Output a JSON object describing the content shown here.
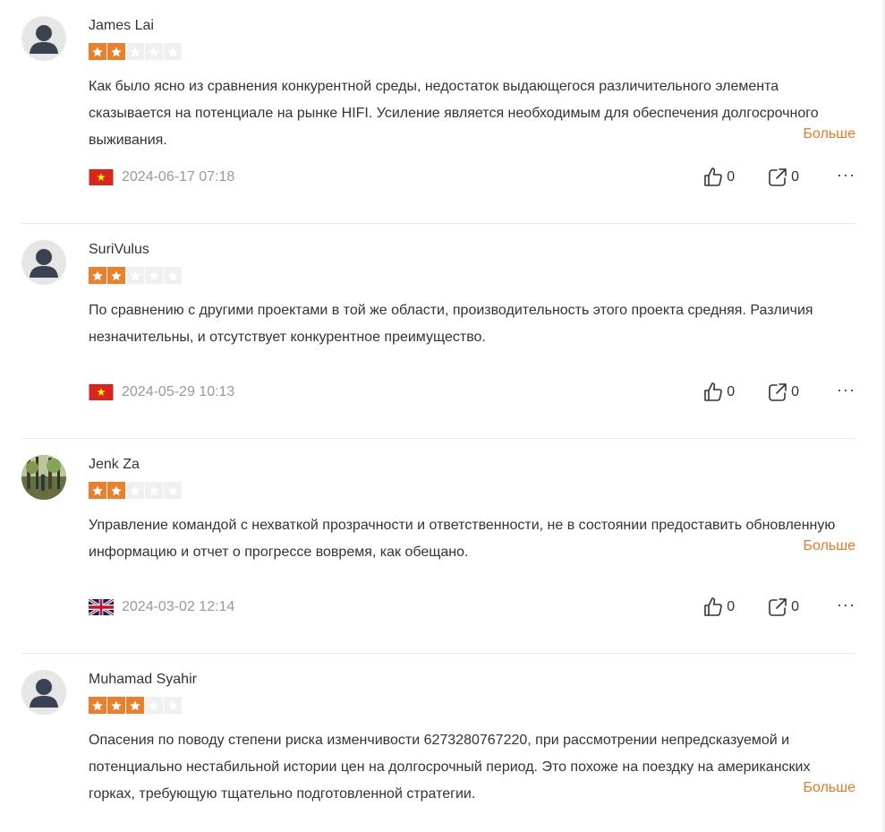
{
  "more_label": "Больше",
  "colors": {
    "accent": "#f07725",
    "star_on": "#ea7f2c",
    "star_off": "#f0f0f0",
    "date": "#999999"
  },
  "icons": {
    "like": "thumbs-up-icon",
    "share": "share-icon",
    "more": "more-horizontal-icon"
  },
  "reviews": [
    {
      "name": "James Lai",
      "rating": 2,
      "text": "Как было ясно из сравнения конкурентной среды, недостаток выдающегося различительного элемента сказывается на потенциале на рынке HIFI. Усиление является необходимым для обеспечения долгосрочного выживания.",
      "country": "vietnam",
      "date": "2024-06-17 07:18",
      "likes": "0",
      "shares": "0",
      "more": "Больше"
    },
    {
      "name": "SuriVulus",
      "rating": 2,
      "text": "По сравнению с другими проектами в той же области, производительность этого проекта средняя. Различия незначительны, и отсутствует конкурентное преимущество.",
      "country": "vietnam",
      "date": "2024-05-29 10:13",
      "likes": "0",
      "shares": "0"
    },
    {
      "name": "Jenk Za",
      "rating": 2,
      "text": "Управление командой с нехваткой прозрачности и ответственности, не в состоянии предоставить обновленную информацию и отчет о прогрессе вовремя, как обещано.",
      "country": "united-kingdom",
      "date": "2024-03-02 12:14",
      "likes": "0",
      "shares": "0",
      "more": "Больше"
    },
    {
      "name": "Muhamad Syahir",
      "rating": 3,
      "text": "Опасения по поводу степени риска изменчивости 6273280767220, при рассмотрении непредсказуемой и потенциально нестабильной истории цен на долгосрочный период. Это похоже на поездку на американских горках, требующую тщательно подготовленной стратегии.",
      "more": "Больше"
    }
  ]
}
